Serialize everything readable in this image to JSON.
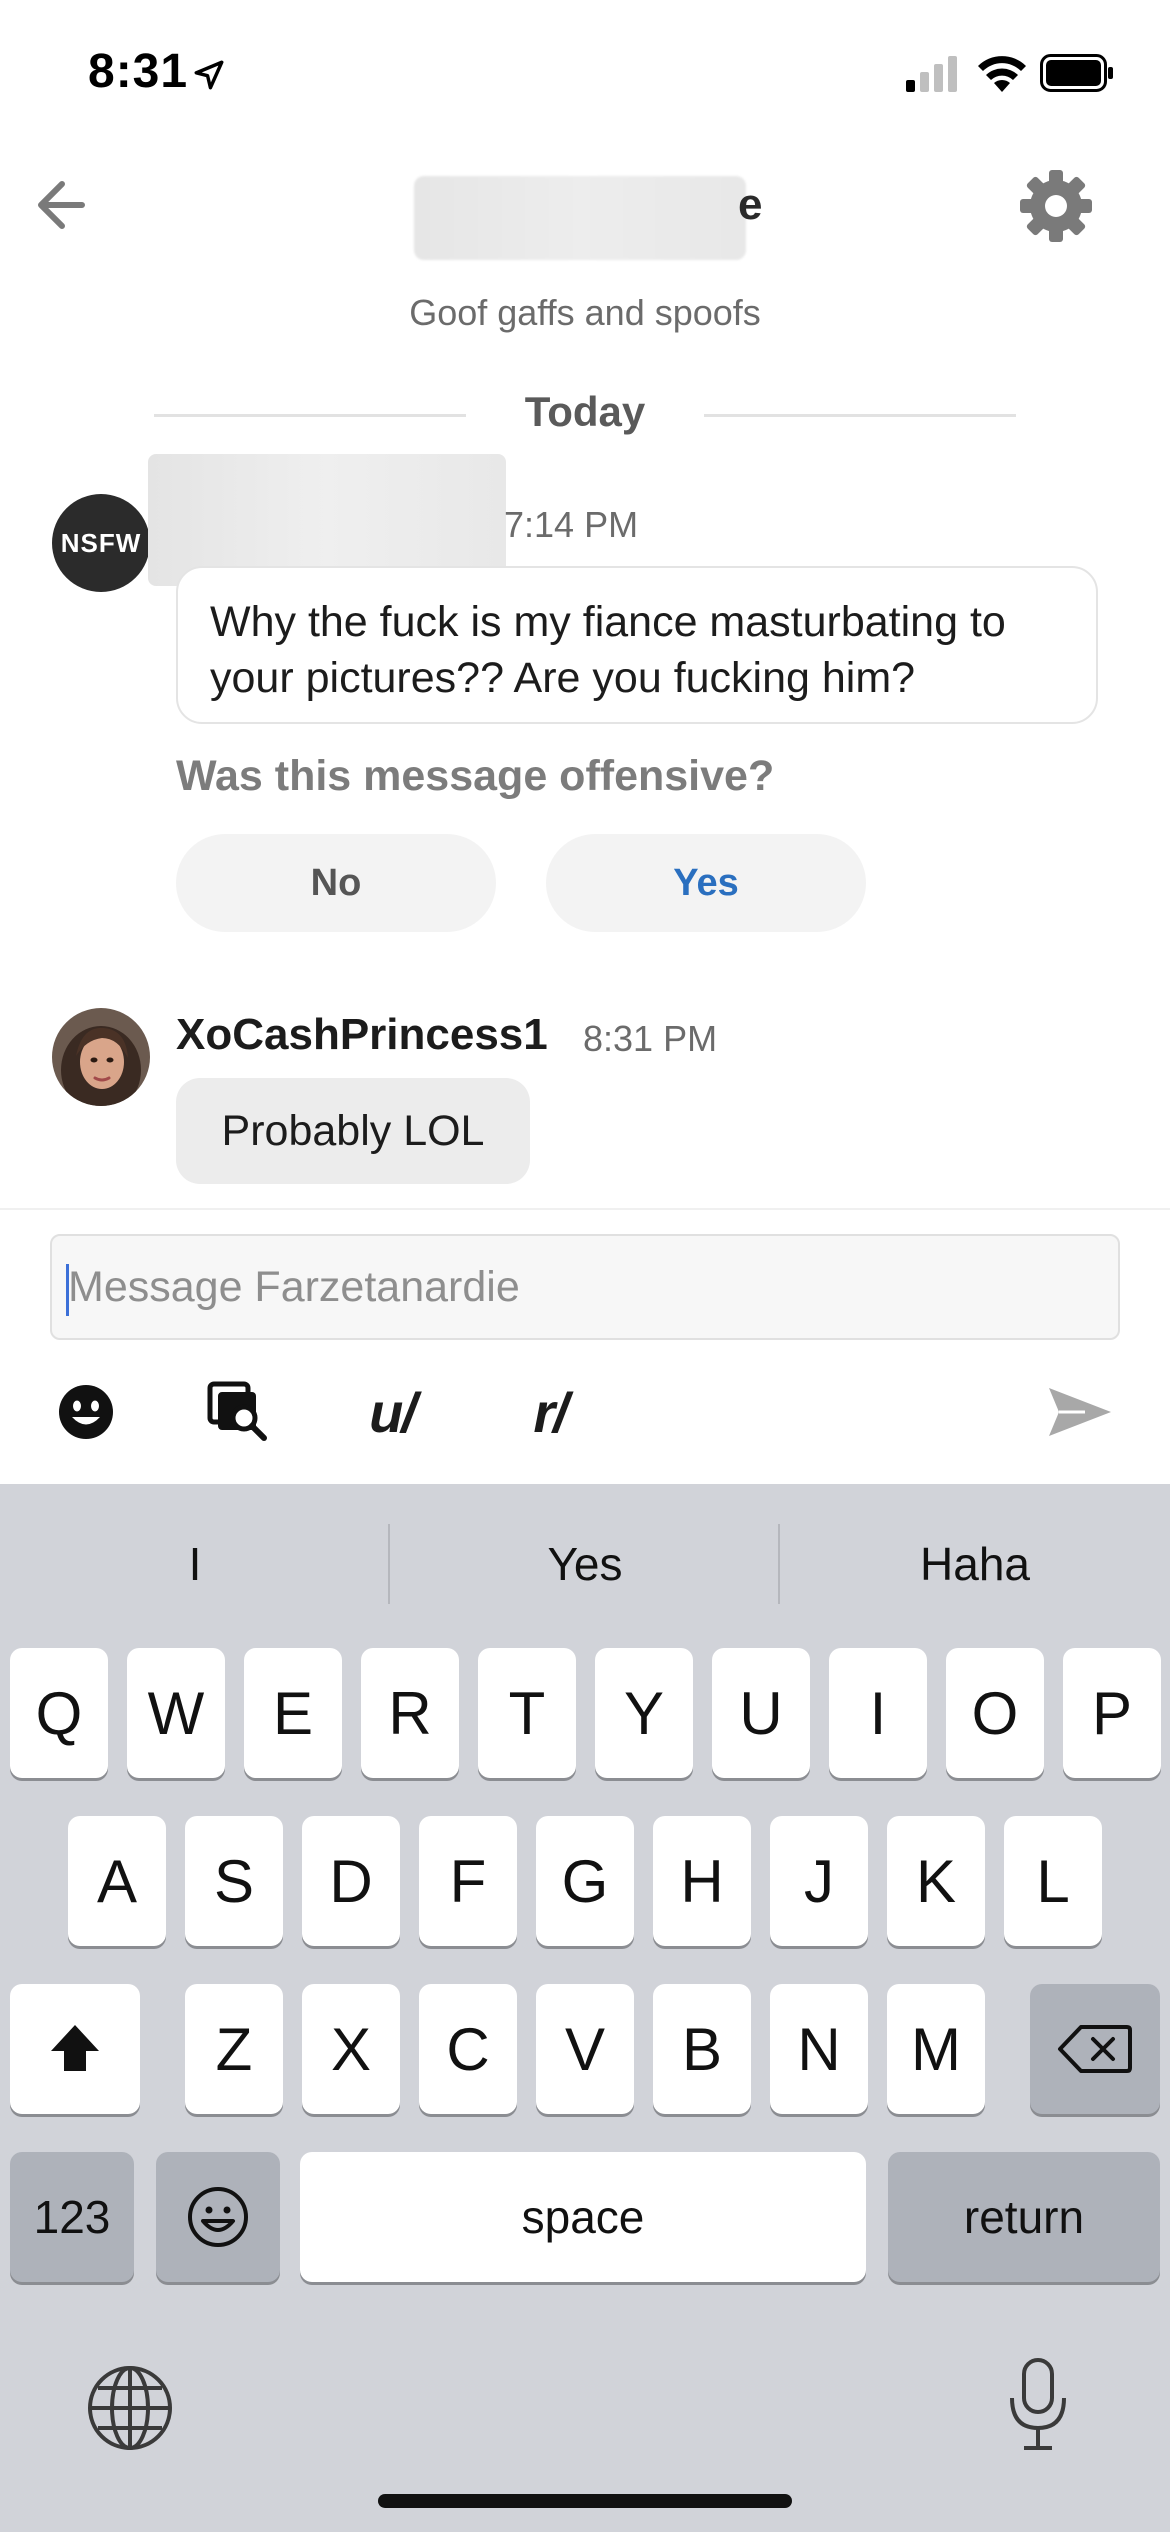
{
  "status_bar": {
    "time": "8:31",
    "icons": [
      "location-arrow-icon",
      "cellular-signal-icon",
      "wifi-icon",
      "battery-icon"
    ]
  },
  "header": {
    "title_visible_fragment": "e",
    "subtitle": "Goof gaffs and spoofs",
    "back_icon": "arrow-left-icon",
    "settings_icon": "gear-icon"
  },
  "conversation": {
    "day_label": "Today",
    "messages": [
      {
        "avatar_label": "NSFW",
        "time": "7:14 PM",
        "text": "Why the fuck is my fiance masturbating to your pictures?? Are you fucking him?"
      },
      {
        "author": "XoCashPrincess1",
        "time": "8:31 PM",
        "text": "Probably LOL"
      }
    ],
    "offensive_prompt": {
      "question": "Was this message offensive?",
      "no_label": "No",
      "yes_label": "Yes"
    }
  },
  "composer": {
    "placeholder": "Message Farzetanardie",
    "tools": {
      "emoji_icon": "emoji-icon",
      "gif_search_icon": "gif-search-icon",
      "user_label": "u/",
      "subreddit_label": "r/",
      "send_icon": "send-icon"
    }
  },
  "keyboard": {
    "suggestions": [
      "I",
      "Yes",
      "Haha"
    ],
    "row1": [
      "Q",
      "W",
      "E",
      "R",
      "T",
      "Y",
      "U",
      "I",
      "O",
      "P"
    ],
    "row2": [
      "A",
      "S",
      "D",
      "F",
      "G",
      "H",
      "J",
      "K",
      "L"
    ],
    "row3": [
      "Z",
      "X",
      "C",
      "V",
      "B",
      "N",
      "M"
    ],
    "numbers_label": "123",
    "space_label": "space",
    "return_label": "return"
  },
  "colors": {
    "accent_blue": "#2a6fbf",
    "keyboard_bg": "#d1d3d9",
    "caret": "#3c70d8"
  }
}
